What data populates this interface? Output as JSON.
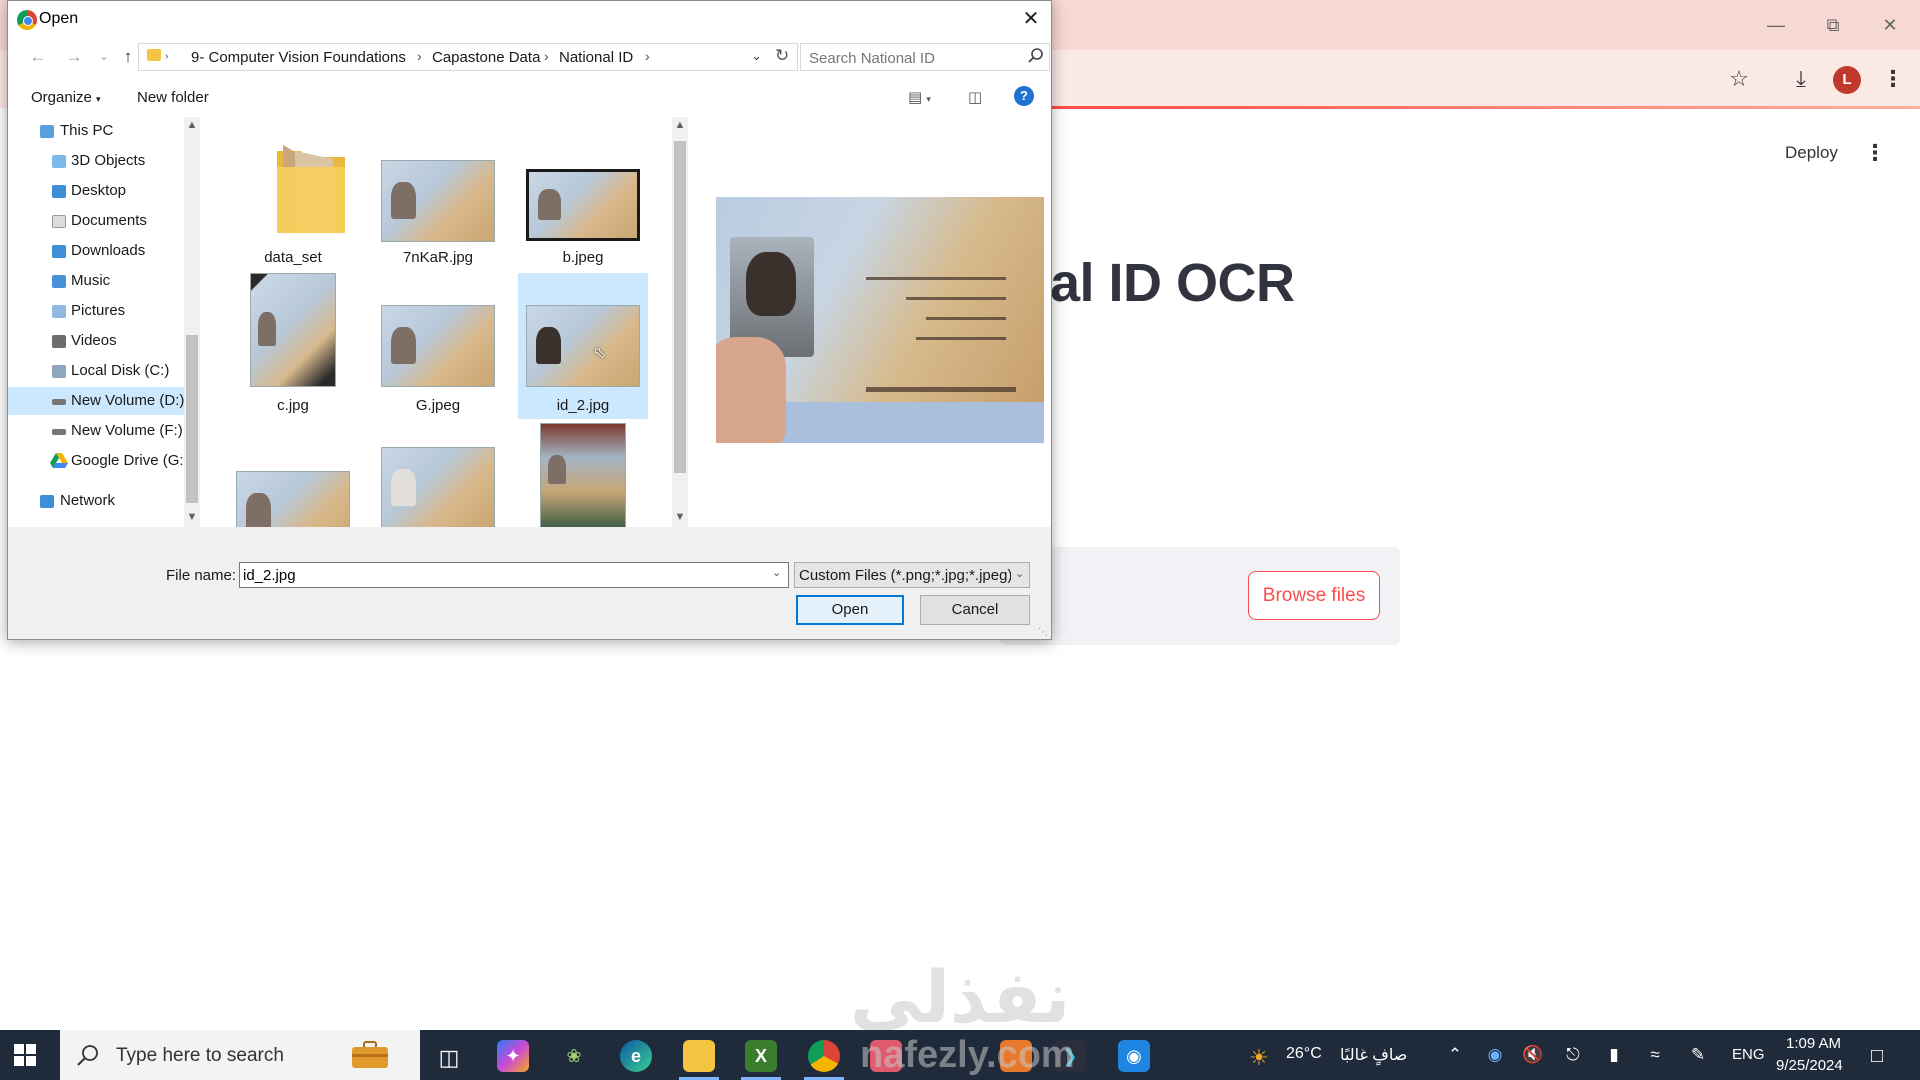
{
  "dialog": {
    "title": "Open",
    "breadcrumbs": [
      "9- Computer Vision Foundations",
      "Capastone Data",
      "National ID"
    ],
    "search_placeholder": "Search National ID",
    "toolbar": {
      "organize": "Organize",
      "new_folder": "New folder"
    },
    "nav_items": [
      {
        "label": "This PC",
        "icon": "pc-icon"
      },
      {
        "label": "3D Objects",
        "icon": "cube-icon"
      },
      {
        "label": "Desktop",
        "icon": "desktop-icon"
      },
      {
        "label": "Documents",
        "icon": "document-icon"
      },
      {
        "label": "Downloads",
        "icon": "download-icon"
      },
      {
        "label": "Music",
        "icon": "music-icon"
      },
      {
        "label": "Pictures",
        "icon": "picture-icon"
      },
      {
        "label": "Videos",
        "icon": "video-icon"
      },
      {
        "label": "Local Disk (C:)",
        "icon": "disk-icon"
      },
      {
        "label": "New Volume (D:)",
        "icon": "drive-icon",
        "selected": true
      },
      {
        "label": "New Volume (F:)",
        "icon": "drive-icon"
      },
      {
        "label": "Google Drive (G:",
        "icon": "google-drive-icon"
      },
      {
        "label": "Network",
        "icon": "network-icon"
      }
    ],
    "files": [
      {
        "name": "data_set",
        "type": "folder"
      },
      {
        "name": "7nKaR.jpg",
        "type": "image"
      },
      {
        "name": "b.jpeg",
        "type": "image"
      },
      {
        "name": "c.jpg",
        "type": "image"
      },
      {
        "name": "G.jpeg",
        "type": "image"
      },
      {
        "name": "id_2.jpg",
        "type": "image",
        "selected": true
      },
      {
        "name": "",
        "type": "image"
      },
      {
        "name": "",
        "type": "image"
      },
      {
        "name": "",
        "type": "image"
      }
    ],
    "file_name_label": "File name:",
    "file_name_value": "id_2.jpg",
    "file_type": "Custom Files (*.png;*.jpg;*.jpeg)",
    "open_button": "Open",
    "cancel_button": "Cancel"
  },
  "browser": {
    "deploy": "Deploy",
    "heading": "al ID OCR",
    "browse_button": "Browse files",
    "profile_initial": "L",
    "accent_color": "#ff4b4b"
  },
  "taskbar": {
    "search_placeholder": "Type here to search",
    "weather_temp": "26°C",
    "weather_text": "صافٍ غالبًا",
    "language": "ENG",
    "time": "1:09 AM",
    "date": "9/25/2024"
  },
  "watermark": "نفذلي",
  "taskbar_watermark": "nafezly.com"
}
